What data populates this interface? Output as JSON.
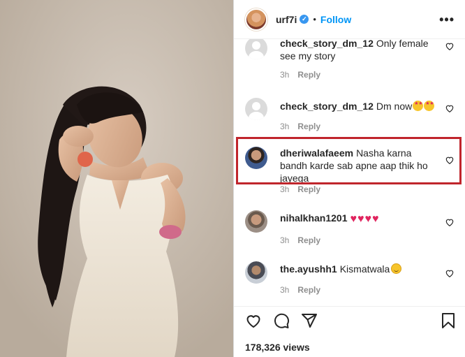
{
  "post": {
    "username": "urf7i",
    "verified_mark": "✓",
    "separator": "•",
    "follow_label": "Follow",
    "more_label": "•••"
  },
  "comments": [
    {
      "user": "check_story_dm_12",
      "text": "Only female see my story",
      "time": "3h",
      "reply": "Reply",
      "avatar": "default-avatar"
    },
    {
      "user": "check_story_dm_12",
      "text": "Dm now",
      "emoji": "star-struck x2",
      "time": "3h",
      "reply": "Reply",
      "avatar": "default-avatar"
    },
    {
      "user": "dheriwalafaeem",
      "text": "Nasha karna bandh karde sab apne aap thik ho jayega",
      "time": "3h",
      "reply": "Reply",
      "avatar": "photo-avatar",
      "highlighted": true
    },
    {
      "user": "nihalkhan1201",
      "text": "",
      "emoji": "red-heart x4",
      "time": "3h",
      "reply": "Reply",
      "avatar": "photo-avatar"
    },
    {
      "user": "the.ayushh1",
      "text": "Kismatwala",
      "emoji": "slightly-smiling-face",
      "time": "3h",
      "reply": "Reply",
      "avatar": "photo-avatar"
    }
  ],
  "icons": [
    "heart-icon",
    "comment-icon",
    "share-icon",
    "bookmark-icon"
  ],
  "views": "178,326 views",
  "colors": {
    "follow": "#0095f6",
    "highlight": "#c0252c",
    "meta": "#8e8e8e",
    "text": "#262626"
  }
}
